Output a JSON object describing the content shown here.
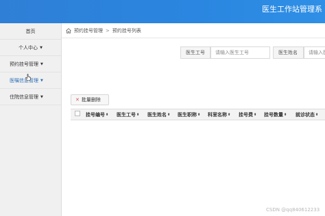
{
  "header": {
    "title": "医生工作站管理系"
  },
  "sidebar": {
    "items": [
      {
        "label": "首页"
      },
      {
        "label": "个人中心"
      },
      {
        "label": "预约挂号管理"
      },
      {
        "label": "医嘱信息管理"
      },
      {
        "label": "住院信息管理"
      }
    ]
  },
  "breadcrumb": {
    "root": "预约挂号管理",
    "separator": ">",
    "current": "预约挂号列表"
  },
  "search": {
    "doctor_id_label": "医生工号",
    "doctor_id_placeholder": "请输入医生工号",
    "doctor_name_label": "医生姓名",
    "doctor_name_placeholder": "请输入医"
  },
  "toolbar": {
    "batch_delete_label": "批量删除"
  },
  "table": {
    "columns": [
      "挂号编号",
      "医生工号",
      "医生姓名",
      "医生职称",
      "科室名称",
      "挂号费",
      "挂号数量",
      "就诊状态"
    ]
  },
  "watermark": "CSDN @qq840612233",
  "colors": {
    "header_bg": "#2a86e0",
    "active_nav": "#2c6fb7",
    "delete_icon": "#d9534f"
  }
}
